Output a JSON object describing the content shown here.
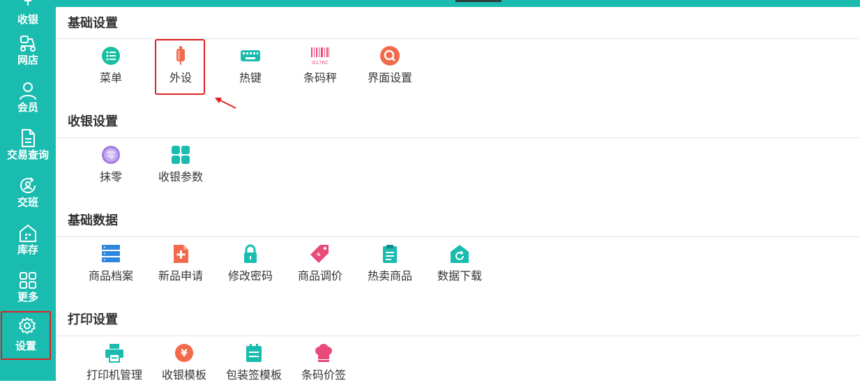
{
  "sidebar": {
    "items": [
      {
        "label": "收银",
        "icon": "cashier-icon"
      },
      {
        "label": "网店",
        "icon": "scooter-icon"
      },
      {
        "label": "会员",
        "icon": "user-icon"
      },
      {
        "label": "交易查询",
        "icon": "document-icon"
      },
      {
        "label": "交班",
        "icon": "shift-handover-icon"
      },
      {
        "label": "库存",
        "icon": "warehouse-icon"
      },
      {
        "label": "更多",
        "icon": "grid-icon"
      },
      {
        "label": "设置",
        "icon": "gear-icon",
        "active": true
      }
    ]
  },
  "sections": [
    {
      "title": "基础设置",
      "items": [
        {
          "label": "菜单",
          "icon": "menu-list-icon",
          "color": "#19BFA0"
        },
        {
          "label": "外设",
          "icon": "peripheral-usb-icon",
          "color": "#F26A4B",
          "highlighted": true
        },
        {
          "label": "热键",
          "icon": "keyboard-icon",
          "color": "#1ABCB0"
        },
        {
          "label": "条码秤",
          "icon": "barcode-icon",
          "color": "#E84A7A",
          "icon_text": "G176C"
        },
        {
          "label": "界面设置",
          "icon": "search-circle-icon",
          "color": "#F26A4B"
        }
      ]
    },
    {
      "title": "收银设置",
      "items": [
        {
          "label": "抹零",
          "icon": "zero-round-icon",
          "color": "#A27AE0",
          "icon_text": "零"
        },
        {
          "label": "收银参数",
          "icon": "four-squares-icon",
          "color": "#1ABCB0"
        }
      ]
    },
    {
      "title": "基础数据",
      "items": [
        {
          "label": "商品档案",
          "icon": "server-stack-icon",
          "color": "#2E86DE"
        },
        {
          "label": "新品申请",
          "icon": "new-file-icon",
          "color": "#F26A4B"
        },
        {
          "label": "修改密码",
          "icon": "lock-icon",
          "color": "#1ABCB0"
        },
        {
          "label": "商品调价",
          "icon": "price-tag-icon",
          "color": "#E84A7A"
        },
        {
          "label": "热卖商品",
          "icon": "clipboard-icon",
          "color": "#1ABCB0"
        },
        {
          "label": "数据下载",
          "icon": "home-refresh-icon",
          "color": "#1ABCB0"
        }
      ]
    },
    {
      "title": "打印设置",
      "items": [
        {
          "label": "打印机管理",
          "icon": "printer-icon",
          "color": "#1ABCB0"
        },
        {
          "label": "收银模板",
          "icon": "yen-coin-icon",
          "color": "#F26A4B"
        },
        {
          "label": "包装签模板",
          "icon": "calendar-icon",
          "color": "#1ABCB0"
        },
        {
          "label": "条码价签",
          "icon": "chef-hat-icon",
          "color": "#E84A7A"
        }
      ]
    }
  ],
  "colors": {
    "sidebar_bg": "#1ABCB0",
    "highlight": "#E02020",
    "text": "#333333"
  }
}
